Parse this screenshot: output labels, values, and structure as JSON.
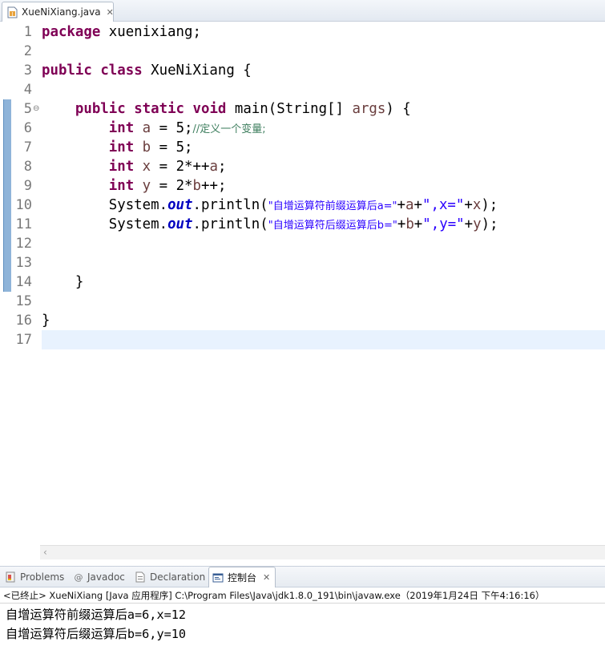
{
  "editor_tab": {
    "title": "XueNiXiang.java",
    "close": "✕"
  },
  "gutter": {
    "line_numbers": [
      "1",
      "2",
      "3",
      "4",
      "5",
      "6",
      "7",
      "8",
      "9",
      "10",
      "11",
      "12",
      "13",
      "14",
      "15",
      "16",
      "17"
    ],
    "fold_marker": "⊖"
  },
  "code": {
    "l1_kw": "package",
    "l1_rest": " xuenixiang;",
    "l3_kw1": "public",
    "l3_kw2": "class",
    "l3_rest": " XueNiXiang {",
    "l5_kw1": "public",
    "l5_kw2": "static",
    "l5_kw3": "void",
    "l5_m": " main(String[] ",
    "l5_var": "args",
    "l5_end": ") {",
    "l6_kw": "int",
    "l6_var": "a",
    "l6_rest": " = 5;",
    "l6_cmt": "//定义一个变量;",
    "l7_kw": "int",
    "l7_var": "b",
    "l7_rest": " = 5;",
    "l8_kw": "int",
    "l8_var": "x",
    "l8_mid": " = 2*++",
    "l8_var2": "a",
    "l8_end": ";",
    "l9_kw": "int",
    "l9_var": "y",
    "l9_mid": " = 2*",
    "l9_var2": "b",
    "l9_end": "++;",
    "l10_sys": "System.",
    "l10_out": "out",
    "l10_pr": ".println(",
    "l10_s1": "\"自增运算符前缀运算后a=\"",
    "l10_p1": "+",
    "l10_v1": "a",
    "l10_p2": "+",
    "l10_s2": "\",x=\"",
    "l10_p3": "+",
    "l10_v2": "x",
    "l10_end": ");",
    "l11_sys": "System.",
    "l11_out": "out",
    "l11_pr": ".println(",
    "l11_s1": "\"自增运算符后缀运算后b=\"",
    "l11_p1": "+",
    "l11_v1": "b",
    "l11_p2": "+",
    "l11_s2": "\",y=\"",
    "l11_p3": "+",
    "l11_v2": "y",
    "l11_end": ");",
    "l14": "}",
    "l16": "}"
  },
  "views": {
    "problems": "Problems",
    "javadoc": "Javadoc",
    "declaration": "Declaration",
    "console": "控制台",
    "close": "✕"
  },
  "console": {
    "header": "<已终止> XueNiXiang [Java 应用程序] C:\\Program Files\\Java\\jdk1.8.0_191\\bin\\javaw.exe（2019年1月24日 下午4:16:16）",
    "output": [
      "自增运算符前缀运算后a=6,x=12",
      "自增运算符后缀运算后b=6,y=10"
    ]
  },
  "colors": {
    "keyword": "#7f0055",
    "local_variable": "#6a3e3e",
    "string": "#2a00ff",
    "static_field": "#0000c0",
    "comment": "#3f7f5f",
    "current_line": "#e8f2fe"
  }
}
